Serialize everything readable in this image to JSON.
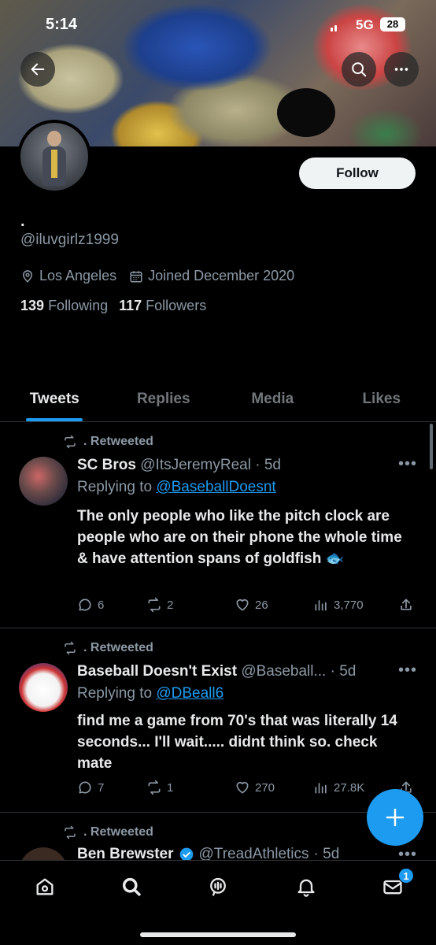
{
  "status_bar": {
    "time": "5:14",
    "network": "5G",
    "battery": "28"
  },
  "profile": {
    "name": ".",
    "handle": "@iluvgirlz1999",
    "location": "Los Angeles",
    "joined": "Joined December 2020",
    "following_count": "139",
    "following_label": "Following",
    "followers_count": "117",
    "followers_label": "Followers",
    "follow_button": "Follow"
  },
  "tabs": [
    "Tweets",
    "Replies",
    "Media",
    "Likes"
  ],
  "active_tab": "Tweets",
  "tweets": [
    {
      "retweet_label": ". Retweeted",
      "display_name": "SC Bros",
      "handle": "@ItsJeremyReal",
      "time": "· 5d",
      "replying_prefix": "Replying to",
      "replying_to": "@BaseballDoesnt",
      "text": "The only people who like the pitch clock are people who are on their phone the whole time & have attention spans of goldfish 🐟",
      "replies": "6",
      "retweets": "2",
      "likes": "26",
      "views": "3,770"
    },
    {
      "retweet_label": ". Retweeted",
      "display_name": "Baseball Doesn't Exist",
      "handle": "@Baseball...",
      "time": "· 5d",
      "replying_prefix": "Replying to",
      "replying_to": "@DBeall6",
      "text": "find me a game from 70's that was literally 14 seconds... I'll wait..... didnt think so. check mate",
      "replies": "7",
      "retweets": "1",
      "likes": "270",
      "views": "27.8K"
    },
    {
      "retweet_label": ". Retweeted",
      "display_name": "Ben Brewster",
      "handle": "@TreadAthletics",
      "time": "· 5d"
    }
  ],
  "bottom_nav": {
    "items": [
      "home-icon",
      "search-icon",
      "spaces-icon",
      "notifications-icon",
      "messages-icon"
    ],
    "messages_badge": "1"
  },
  "colors": {
    "accent": "#1d9bf0",
    "background": "#000000",
    "secondary_text": "#8b98a5"
  }
}
